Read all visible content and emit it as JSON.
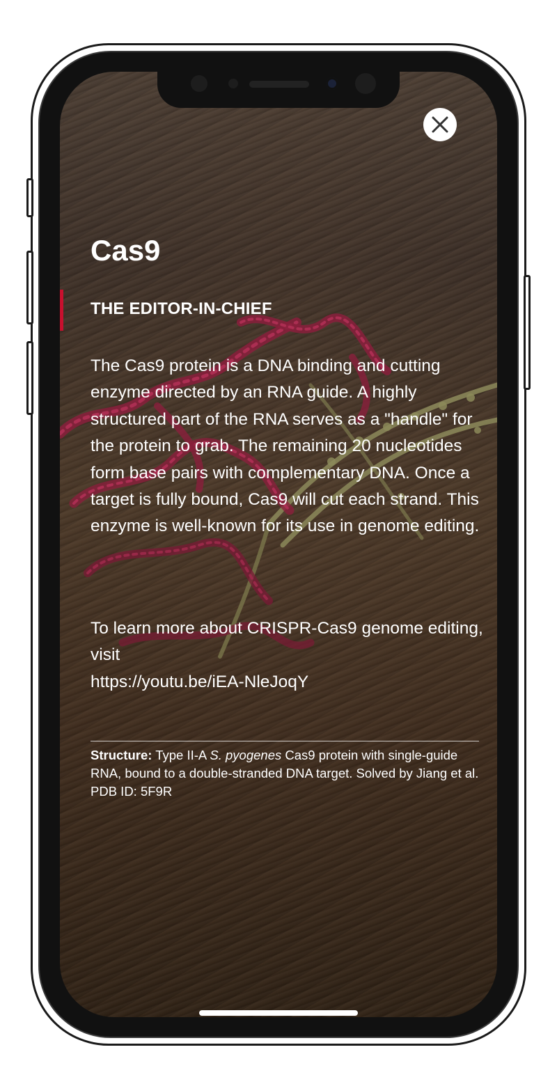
{
  "card": {
    "title": "Cas9",
    "subtitle": "THE EDITOR-IN-CHIEF",
    "description": "The Cas9 protein is a DNA binding and cutting enzyme directed by an RNA guide. A highly structured part of the RNA serves as a \"handle\" for the protein to grab. The remaining 20 nucleotides form base pairs with complementary DNA. Once a target is fully bound, Cas9 will cut each strand. This enzyme is well-known for its use in genome editing.",
    "learn_more_prefix": "To learn more about CRISPR-Cas9 genome editing, visit",
    "learn_more_link": "https://youtu.be/iEA-NleJoqY",
    "structure_label": "Structure:",
    "structure_text_1": "Type II-A",
    "structure_species": "S. pyogenes",
    "structure_text_2": "Cas9 protein with single-guide RNA, bound to a double-stranded DNA target. Solved by Jiang et al. PDB ID: 5F9R"
  },
  "close_button": {
    "icon": "close-icon"
  },
  "colors": {
    "accent": "#c8102e",
    "protein": "#8a1f3c",
    "dna": "#8c8a5a",
    "text": "#ffffff"
  }
}
